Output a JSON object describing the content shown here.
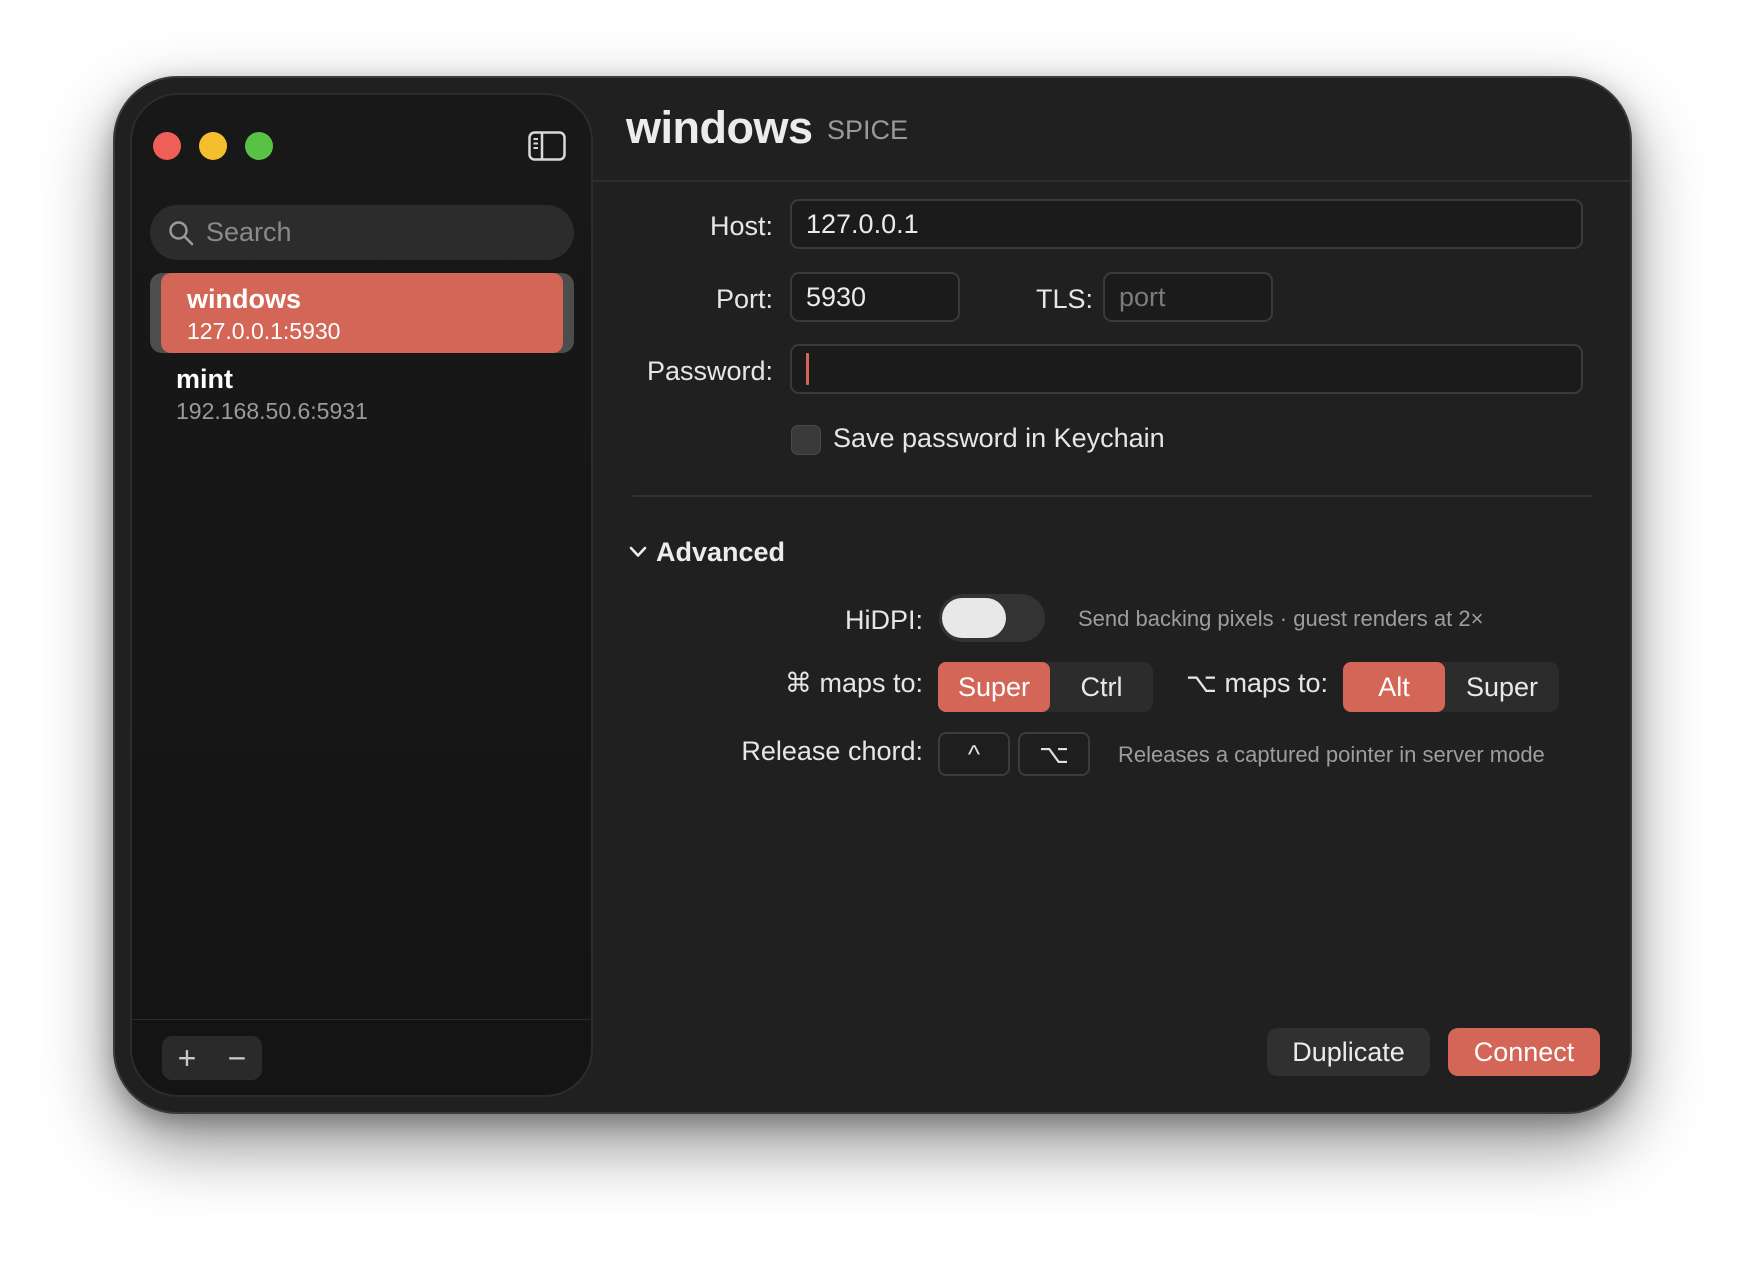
{
  "sidebar": {
    "search_placeholder": "Search",
    "connections": [
      {
        "name": "windows",
        "address": "127.0.0.1:5930",
        "selected": true
      },
      {
        "name": "mint",
        "address": "192.168.50.6:5931",
        "selected": false
      }
    ],
    "add_label": "+",
    "remove_label": "−"
  },
  "header": {
    "title": "windows",
    "protocol": "SPICE"
  },
  "form": {
    "host_label": "Host:",
    "host_value": "127.0.0.1",
    "port_label": "Port:",
    "port_value": "5930",
    "tls_label": "TLS:",
    "tls_placeholder": "port",
    "password_label": "Password:",
    "password_value": "",
    "keychain_label": "Save password in Keychain",
    "keychain_checked": false
  },
  "advanced": {
    "title": "Advanced",
    "expanded": true,
    "hidpi_label": "HiDPI:",
    "hidpi_on": false,
    "hidpi_hint": "Send backing pixels · guest renders at 2×",
    "cmd_label": "⌘ maps to:",
    "cmd_options": [
      "Super",
      "Ctrl"
    ],
    "cmd_selected": "Super",
    "opt_label": "⌥ maps to:",
    "opt_options": [
      "Alt",
      "Super"
    ],
    "opt_selected": "Alt",
    "release_label": "Release chord:",
    "release_keys": [
      "^",
      "⌥"
    ],
    "release_hint": "Releases a captured pointer in server mode"
  },
  "actions": {
    "duplicate_label": "Duplicate",
    "connect_label": "Connect"
  },
  "colors": {
    "accent": "#d36656",
    "background": "#202020",
    "sidebar": "#161616",
    "close": "#ee5f57",
    "minimize": "#f5be2f",
    "zoom": "#58c245"
  },
  "icons": {
    "sidebar_toggle": "sidebar-toggle-icon",
    "search": "search-icon",
    "disclosure": "chevron-down-icon"
  }
}
